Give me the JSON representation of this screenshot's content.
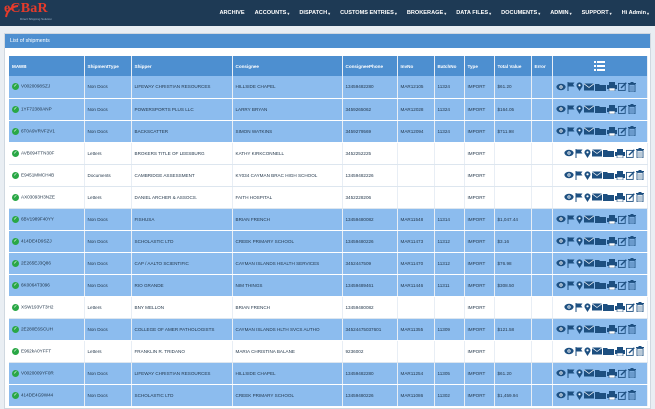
{
  "brand": {
    "name": "eCBaR",
    "tagline": "Direct Shipping Solution"
  },
  "nav": [
    {
      "label": "ARCHIVE",
      "caret": false
    },
    {
      "label": "ACCOUNTS",
      "caret": true
    },
    {
      "label": "DISPATCH",
      "caret": true
    },
    {
      "label": "CUSTOMS ENTRIES",
      "caret": true
    },
    {
      "label": "BROKERAGE",
      "caret": true
    },
    {
      "label": "DATA FILES",
      "caret": true
    },
    {
      "label": "DOCUMENTS",
      "caret": true
    },
    {
      "label": "ADMIN",
      "caret": true
    },
    {
      "label": "SUPPORT",
      "caret": true
    },
    {
      "label": "Hi Admin",
      "caret": true
    }
  ],
  "panel_title": "List of shipments",
  "columns": [
    "MAWB",
    "ShipmentType",
    "Shipper",
    "Consignee",
    "ConsigneePhone",
    "InvNo",
    "BatchNo",
    "Type",
    "Total Value",
    "Error"
  ],
  "rows": [
    {
      "mawb": "V0020098SZJ",
      "type": "Non Docs",
      "shipper": "LIFEWAY CHRISTIAN RESOURCES",
      "consignee": "HILLSIDE CHAPEL",
      "phone": "13459482280",
      "inv": "MAR12105",
      "batch": "11324",
      "kind": "IMPORT",
      "value": "$61.20",
      "color": "blue"
    },
    {
      "mawb": "1YF72380ANP",
      "type": "Non Docs",
      "shipper": "POWERSPORTS PLUS LLC",
      "consignee": "LARRY BRYAN",
      "phone": "3459265062",
      "inv": "MAR12028",
      "batch": "11324",
      "kind": "IMPORT",
      "value": "$164.05",
      "color": "blue"
    },
    {
      "mawb": "6T0A9VRVF2V1",
      "type": "Non Docs",
      "shipper": "BACKSCATTER",
      "consignee": "SIMON WATKINS",
      "phone": "3459279569",
      "inv": "MAR12094",
      "batch": "11324",
      "kind": "IMPORT",
      "value": "$711.98",
      "color": "blue"
    },
    {
      "mawb": "AVB094TTN30F",
      "type": "Letters",
      "shipper": "BROKERS TITLE OF LEESBURG",
      "consignee": "KATHY KIRKCONNELL",
      "phone": "3452252225",
      "inv": "",
      "batch": "",
      "kind": "IMPORT",
      "value": "",
      "color": "white"
    },
    {
      "mawb": "E9451MMCH4B",
      "type": "Documents",
      "shipper": "CAMBRIDGE ASSESSMENT",
      "consignee": "KY034 CAYMAN BRAC HIGH SCHOOL",
      "phone": "13459482226",
      "inv": "",
      "batch": "",
      "kind": "IMPORT",
      "value": "",
      "color": "white"
    },
    {
      "mawb": "AX03093H3NZE",
      "type": "Letters",
      "shipper": "DANIEL ARCHER & ASSOCS.",
      "consignee": "FAITH HOSPITAL",
      "phone": "3452228206",
      "inv": "",
      "batch": "",
      "kind": "IMPORT",
      "value": "",
      "color": "white"
    },
    {
      "mawb": "6BV1989F40YY",
      "type": "Non Docs",
      "shipper": "FISHUSA",
      "consignee": "BRIAN FRENCH",
      "phone": "13459480082",
      "inv": "MAR11548",
      "batch": "11314",
      "kind": "IMPORT",
      "value": "$1,047.44",
      "color": "blue"
    },
    {
      "mawb": "414DE4D9SZJ",
      "type": "Non Docs",
      "shipper": "SCHOLASTIC LTD",
      "consignee": "CREEK PRIMARY SCHOOL",
      "phone": "13459480226",
      "inv": "MAR11473",
      "batch": "11312",
      "kind": "IMPORT",
      "value": "$3.16",
      "color": "blue"
    },
    {
      "mawb": "2E265EJ3Q86",
      "type": "Non Docs",
      "shipper": "CAP / AALTO SCIENTIFIC",
      "consignee": "CAYMAN ISLANDS HEALTH SERVICES",
      "phone": "3452447509",
      "inv": "MAR11470",
      "batch": "11312",
      "kind": "IMPORT",
      "value": "$76.98",
      "color": "blue"
    },
    {
      "mawb": "6K0064T3096",
      "type": "Non Docs",
      "shipper": "RIO GRANDE",
      "consignee": "NIM THINGS",
      "phone": "13459489461",
      "inv": "MAR11446",
      "batch": "11311",
      "kind": "IMPORT",
      "value": "$308.50",
      "color": "blue"
    },
    {
      "mawb": "XSW193VT3H2",
      "type": "Letters",
      "shipper": "BNY MELLON",
      "consignee": "BRIAN FRENCH",
      "phone": "13459480082",
      "inv": "",
      "batch": "",
      "kind": "IMPORT",
      "value": "",
      "color": "white"
    },
    {
      "mawb": "2E280E6SCUH",
      "type": "Non Docs",
      "shipper": "COLLEGE OF AMER PATHOLOGISTS",
      "consignee": "CAYMAN ISLANDS HLTH SVCS AUTHO",
      "phone": "34524475037601",
      "inv": "MAR11355",
      "batch": "11309",
      "kind": "IMPORT",
      "value": "$121.58",
      "color": "blue"
    },
    {
      "mawb": "E962kA0YFFT",
      "type": "Letters",
      "shipper": "FRANKLIN R. TRIDANO",
      "consignee": "MARIA CHRISTINA BALANE",
      "phone": "9236002",
      "inv": "",
      "batch": "",
      "kind": "IMPORT",
      "value": "",
      "color": "white"
    },
    {
      "mawb": "V0020009YF0R",
      "type": "Non Docs",
      "shipper": "LIFEWAY CHRISTIAN RESOURCES",
      "consignee": "HILLSIDE CHAPEL",
      "phone": "13459482280",
      "inv": "MAR11254",
      "batch": "11305",
      "kind": "IMPORT",
      "value": "$61.20",
      "color": "blue"
    },
    {
      "mawb": "414DE4G9W44",
      "type": "Non Docs",
      "shipper": "SCHOLASTIC LTD",
      "consignee": "CREEK PRIMARY SCHOOL",
      "phone": "13459480226",
      "inv": "MAR11086",
      "batch": "11302",
      "kind": "IMPORT",
      "value": "$1,459.94",
      "color": "blue"
    }
  ],
  "icons": [
    "eye-icon",
    "flag-icon",
    "location-pin-icon",
    "envelope-icon",
    "folder-icon",
    "printer-icon",
    "edit-icon",
    "trash-icon"
  ],
  "colors": {
    "navbar": "#1e3a55",
    "header": "#4d8fd0",
    "row_blue": "#8cbcee",
    "check": "#29a745",
    "icon": "#1d4f80"
  }
}
